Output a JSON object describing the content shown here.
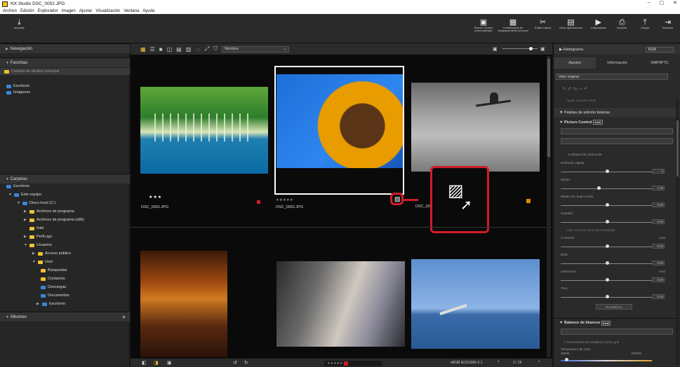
{
  "window": {
    "title": "NX Studio   DSC_0002.JPG",
    "min": "–",
    "max": "▢",
    "close": "✕"
  },
  "menu": [
    "Archivo",
    "Edición",
    "Explorador",
    "Imagen",
    "Ajustar",
    "Visualización",
    "Ventana",
    "Ayuda"
  ],
  "toolbar": {
    "import": "Importar",
    "picture_control": "Picture Control personalizado",
    "pixel_shift": "Combinación de desplazamiento de píxel",
    "edit_videos": "Editar vídeos",
    "other_apps": "Otras aplicaciones",
    "slideshow": "Diapositivas",
    "print": "Imprimir",
    "upload": "Cargar",
    "export": "Exportar"
  },
  "left": {
    "navigation": "Navegación",
    "favorites": "Favoritas",
    "favorites_items": [
      "Carpeta de destino principal",
      "Escritorio",
      "Imágenes"
    ],
    "folders": "Carpetas",
    "tree": [
      "Escritorio",
      "Este equipo",
      "Disco local (C:)",
      "Archivos de programa",
      "Archivos de programa (x86)",
      "Intel",
      "PerfLogs",
      "Usuarios",
      "Acceso público",
      "User",
      "Búsquedas",
      "Contactos",
      "Descargas",
      "Documentos",
      "Escritorio"
    ],
    "albums": "Álbumes"
  },
  "center": {
    "sort": "Nombre",
    "thumbs": [
      {
        "name": "DSC_0001.JPG",
        "stars": "★★★"
      },
      {
        "name": "DSC_0002.JPG",
        "stars": "★★★★★"
      },
      {
        "name": "DSC_000",
        "stars": ""
      }
    ],
    "rating_bar": "★★★★★",
    "color_profile": "sRGB IEC61966-2.1",
    "page": "2 / 16"
  },
  "right": {
    "histogram": "Histograma",
    "histogram_mode": "RGB",
    "tabs": [
      "Ajustes",
      "Información",
      "XMP/IPTC"
    ],
    "preset": "Valor original",
    "hdr": "Ajuste creación HDR",
    "basic_palettes": "Paletas de edición básicas",
    "picture_control": "Picture Control",
    "advanced": "Configuración avanzada",
    "quick_sharp": "Definición rápida",
    "sharpness": "Nitidez",
    "mid_sharp": "Nitidez de rango medio",
    "clarity": "Claridad",
    "curve": "Usar curva de tonos personalizada",
    "contrast": "Contraste",
    "brightness": "Brillo",
    "saturation": "Saturación",
    "hue": "Tono",
    "auto": "Auto",
    "reset": "Restablecer",
    "white_balance": "Balance de blancos",
    "wb_tool": "Herramienta de establecer punto gris",
    "color_temp": "Temperatura de color",
    "wb_min": "2500K",
    "wb_max": "10000K",
    "val_100": "1.00",
    "val_000": "0.00",
    "val_0": "0",
    "raw_badge": "RAW"
  }
}
